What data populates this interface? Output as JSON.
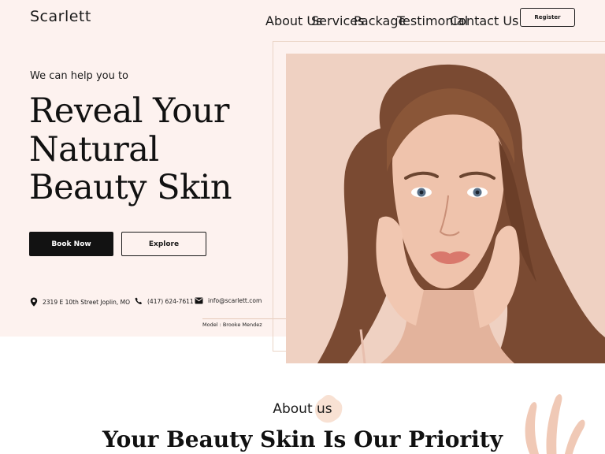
{
  "brand": {
    "logo": "Scarlett"
  },
  "nav": {
    "items": [
      {
        "label": "About Us"
      },
      {
        "label": "Services"
      },
      {
        "label": "Package"
      },
      {
        "label": "Testimonial"
      },
      {
        "label": "Contact Us"
      }
    ],
    "register_label": "Register"
  },
  "hero": {
    "kicker": "We can help you to",
    "headline": [
      "Reveal Your",
      "Natural",
      "Beauty Skin"
    ],
    "book_label": "Book Now",
    "explore_label": "Explore",
    "address": "2319 E 10th Street Joplin, MO",
    "phone": "(417) 624-7611",
    "email": "info@scarlett.com",
    "model_credit": "Model : Brooke Mendez"
  },
  "about": {
    "title": "About us",
    "heading": "Your Beauty Skin Is Our Priority"
  },
  "colors": {
    "hero_bg": "#fdf2ef",
    "photo_bg": "#efd1c2",
    "accent": "#f4dcc9",
    "dark": "#121212"
  },
  "icons": [
    "location-pin-icon",
    "phone-icon",
    "mail-icon",
    "leaf-decoration-icon"
  ]
}
